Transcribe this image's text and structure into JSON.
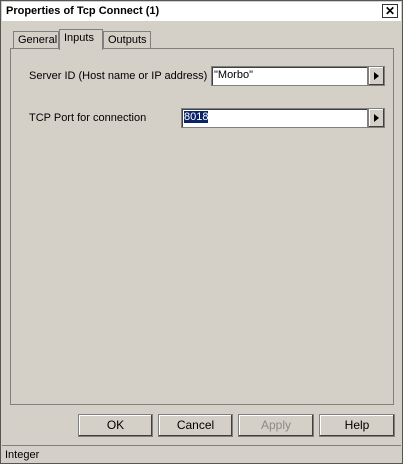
{
  "window": {
    "title": "Properties of Tcp Connect (1)"
  },
  "tabs": [
    "General",
    "Inputs",
    "Outputs"
  ],
  "active_tab": "Inputs",
  "fields": [
    {
      "label": "Server ID (Host name or IP address)",
      "value": "\"Morbo\""
    },
    {
      "label": "TCP Port for connection",
      "value": "8018"
    }
  ],
  "buttons": {
    "ok": "OK",
    "cancel": "Cancel",
    "apply": "Apply",
    "help": "Help"
  },
  "status": {
    "text": "Integer"
  },
  "icons": {
    "close": "close-icon",
    "arrow": "arrow-right-icon"
  }
}
